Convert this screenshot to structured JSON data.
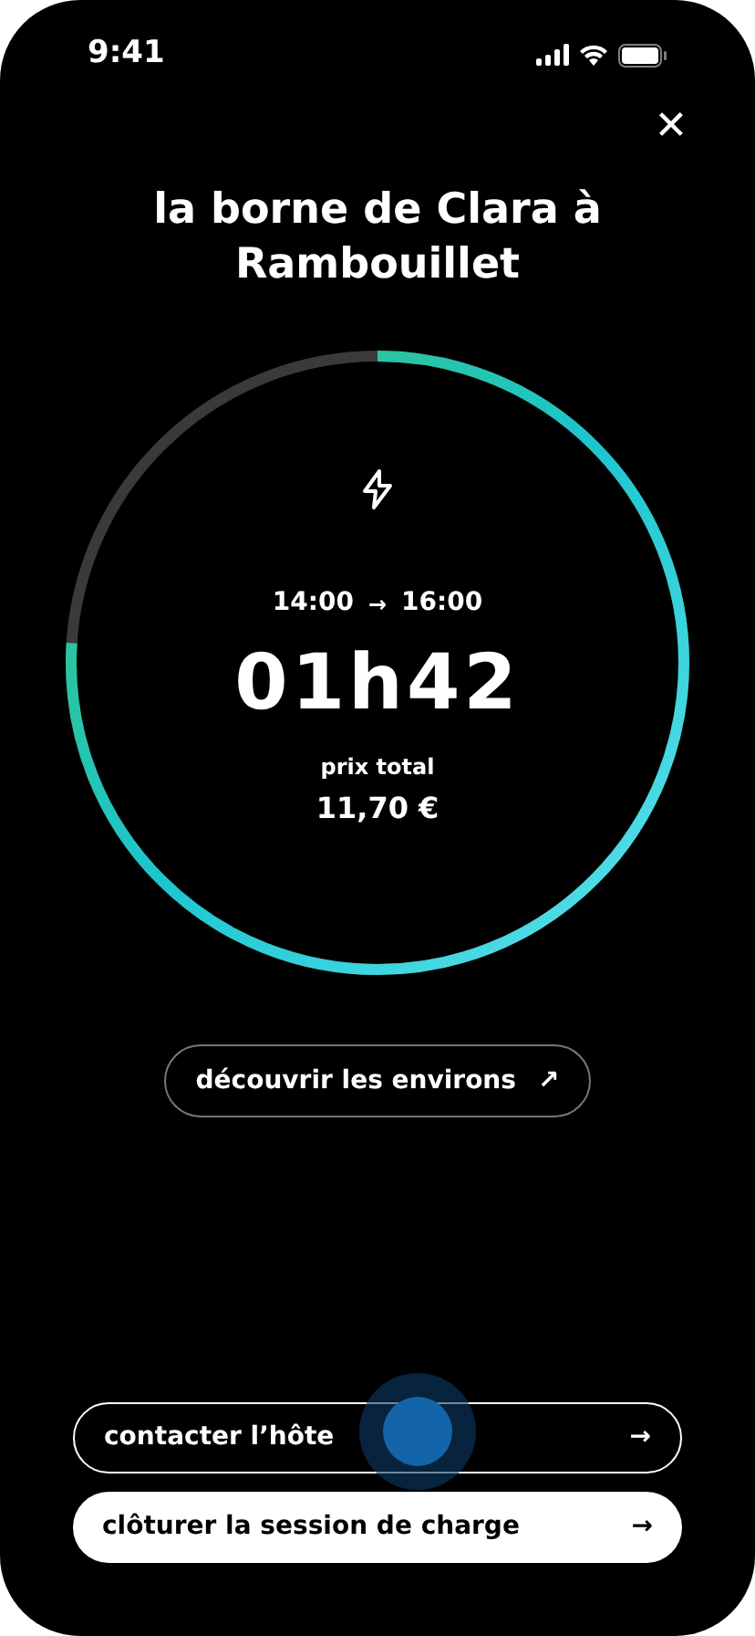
{
  "status_bar": {
    "time": "9:41"
  },
  "close_button": {
    "label": "✕"
  },
  "title": "la borne de Clara à Rambouillet",
  "session": {
    "level": 0.76,
    "start": "14:00",
    "arrow": "→",
    "end": "16:00",
    "duration": "01h42",
    "price_label": "prix total",
    "price": "11,70 €"
  },
  "explore_button": {
    "label": "découvrir les environs",
    "icon": "↗"
  },
  "actions": [
    {
      "label": "contacter l’hôte",
      "icon": "→",
      "kind": "outline"
    },
    {
      "label": "clôturer la session de charge",
      "icon": "→",
      "kind": "filled"
    }
  ]
}
